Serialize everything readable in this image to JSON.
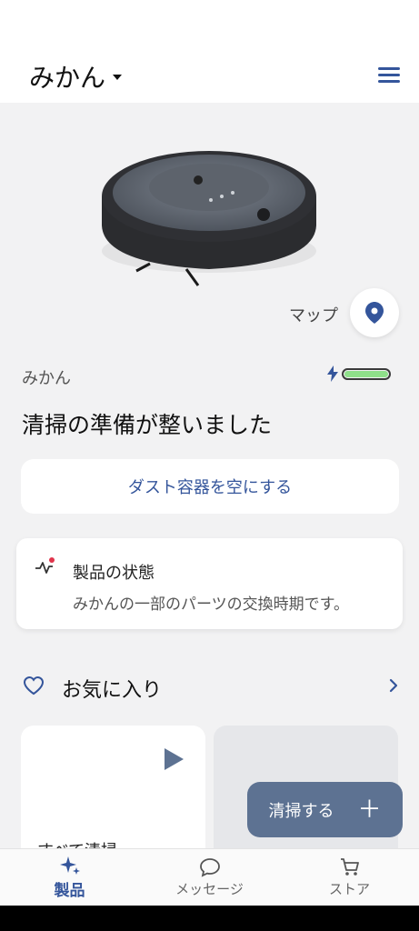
{
  "header": {
    "robot_name": "みかん"
  },
  "map": {
    "label": "マップ"
  },
  "robot": {
    "name": "みかん",
    "battery_fraction": 1.0,
    "status": "清掃の準備が整いました"
  },
  "actions": {
    "empty_bin": "ダスト容器を空にする"
  },
  "health": {
    "title": "製品の状態",
    "message": "みかんの一部のパーツの交換時期です。"
  },
  "favorites": {
    "title": "お気に入り",
    "card1_label": "すべて清掃"
  },
  "fab": {
    "label": "清掃する",
    "plus": "＋"
  },
  "nav": {
    "products": "製品",
    "messages": "メッセージ",
    "store": "ストア"
  },
  "colors": {
    "accent": "#34559b",
    "fab": "#5d7292",
    "battery": "#8fe08a",
    "background": "#f2f2f3"
  }
}
